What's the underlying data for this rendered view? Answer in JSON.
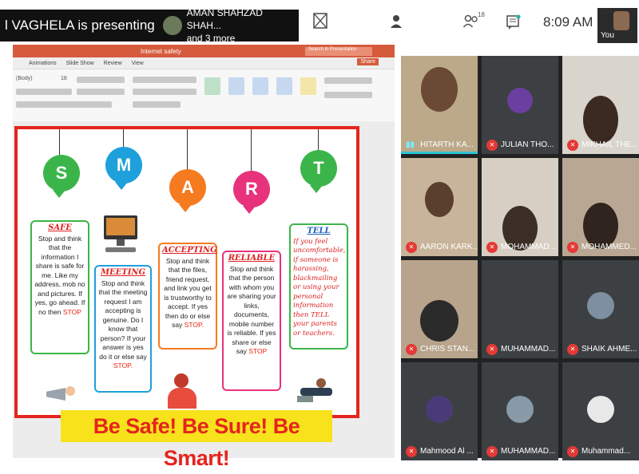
{
  "topbar": {
    "presenter_text": "l VAGHELA is presenting",
    "participant_name": "AMAN SHAHZAD SHAH...",
    "participant_more": "and 3 more",
    "people_count": "18",
    "time": "8:09 AM",
    "self_label": "You"
  },
  "powerpoint": {
    "file_name": "Internet safety",
    "search_placeholder": "Search in Presentation",
    "tabs": [
      "Animations",
      "Slide Show",
      "Review",
      "View"
    ],
    "share_label": "Share",
    "font_name": "(Body)",
    "font_size": "18"
  },
  "slide": {
    "letters": [
      "S",
      "M",
      "A",
      "R",
      "T"
    ],
    "letter_colors": [
      "#3bb54a",
      "#1ea0db",
      "#f57b20",
      "#e8327c",
      "#3bb54a"
    ],
    "cards": [
      {
        "title": "SAFE",
        "body": "Stop and think that the information I share is safe for me. Like my address, mob no and pictures. If yes, go ahead. If no then",
        "stop": "STOP",
        "border": "#3bb54a"
      },
      {
        "title": "MEETING",
        "body": "Stop and think that the meeting request I am accepting is genuine. Do I know that person? If your answer is yes do it or else say",
        "stop": "STOP.",
        "border": "#1ea0db"
      },
      {
        "title": "ACCEPTING",
        "body": "Stop and think that the files, friend request, and link you get is trustworthy to accept. If yes then do or else say",
        "stop": "STOP.",
        "border": "#f57b20"
      },
      {
        "title": "RELIABLE",
        "body": "Stop and think that the person with whom you are sharing your links, documents, mobile number is reliable. If yes share or else say",
        "stop": "STOP",
        "border": "#e8327c"
      },
      {
        "title": "TELL",
        "body": "If you feel uncomfortable, if someone is harassing, blackmailing or using your personal information then TELL your parents or teachers.",
        "stop": "",
        "border": "#3bb54a"
      }
    ],
    "banner": "Be Safe!  Be Sure!  Be Smart!"
  },
  "participants": [
    {
      "name": "HITARTH KA...",
      "muted": false
    },
    {
      "name": "JULIAN THO...",
      "muted": true
    },
    {
      "name": "MIKHAIL THE...",
      "muted": true
    },
    {
      "name": "AARON KARK...",
      "muted": true
    },
    {
      "name": "MOHAMMAD...",
      "muted": true
    },
    {
      "name": "MOHAMMED...",
      "muted": true
    },
    {
      "name": "CHRIS STAN...",
      "muted": true
    },
    {
      "name": "MUHAMMAD...",
      "muted": true
    },
    {
      "name": "SHAIK AHME...",
      "muted": true
    },
    {
      "name": "Mahmood Al ...",
      "muted": true
    },
    {
      "name": "MUHAMMAD...",
      "muted": true
    },
    {
      "name": "Muhammad...",
      "muted": true
    }
  ]
}
